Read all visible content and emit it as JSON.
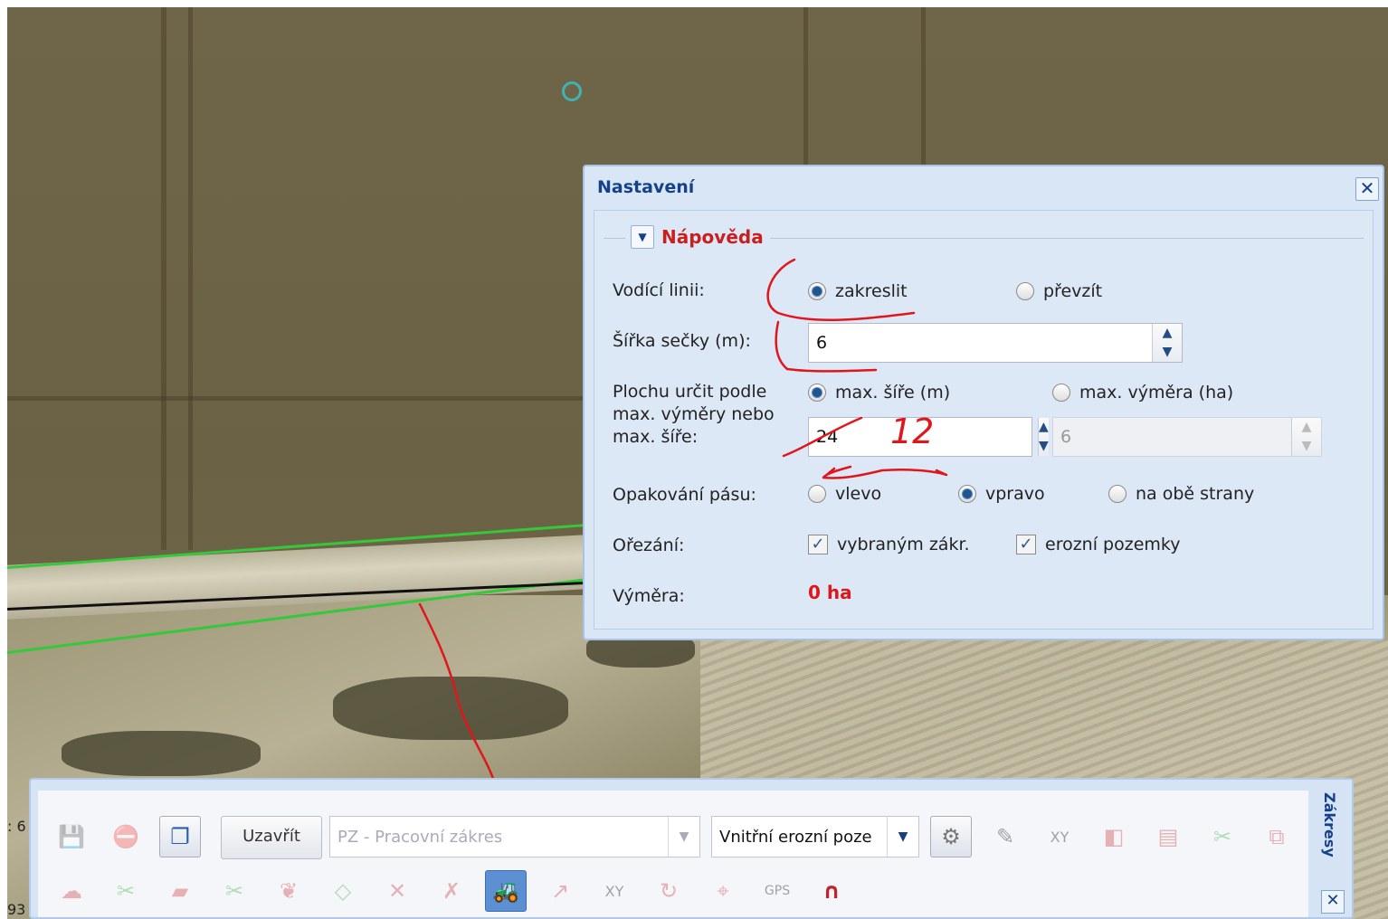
{
  "map": {
    "scale_left_top": ": 6",
    "scale_left_bottom": "93"
  },
  "dialog": {
    "title": "Nastavení",
    "help_legend": "Nápověda",
    "guide_line": {
      "label": "Vodící linii:",
      "options": [
        "zakreslit",
        "převzít"
      ],
      "selected": "zakreslit"
    },
    "swath_width": {
      "label": "Šířka sečky (m):",
      "value": "6"
    },
    "area_by": {
      "label": "Plochu určit podle max. výměry nebo max. šíře:",
      "options": [
        "max. šíře (m)",
        "max. výměra (ha)"
      ],
      "selected": "max. šíře (m)",
      "max_width_value": "24",
      "max_area_value": "6"
    },
    "strip_repeat": {
      "label": "Opakování pásu:",
      "options": [
        "vlevo",
        "vpravo",
        "na obě strany"
      ],
      "selected": "vpravo"
    },
    "clipping": {
      "label": "Ořezání:",
      "options": [
        "vybraným zákr.",
        "erozní pozemky"
      ],
      "checked": [
        true,
        true
      ]
    },
    "area": {
      "label": "Výměra:",
      "value": "0 ha"
    },
    "annotation_text": "12"
  },
  "toolbar": {
    "close_label": "Uzavřít",
    "layer_combo_value": "PZ - Pracovní zákres",
    "erosion_combo_value": "Vnitřní erozní poze",
    "side_tab_label": "Zákresy",
    "colors": {
      "active_button": "#5d8fd3",
      "tractor": "#d9302b",
      "magnet": "#c0232a"
    }
  }
}
